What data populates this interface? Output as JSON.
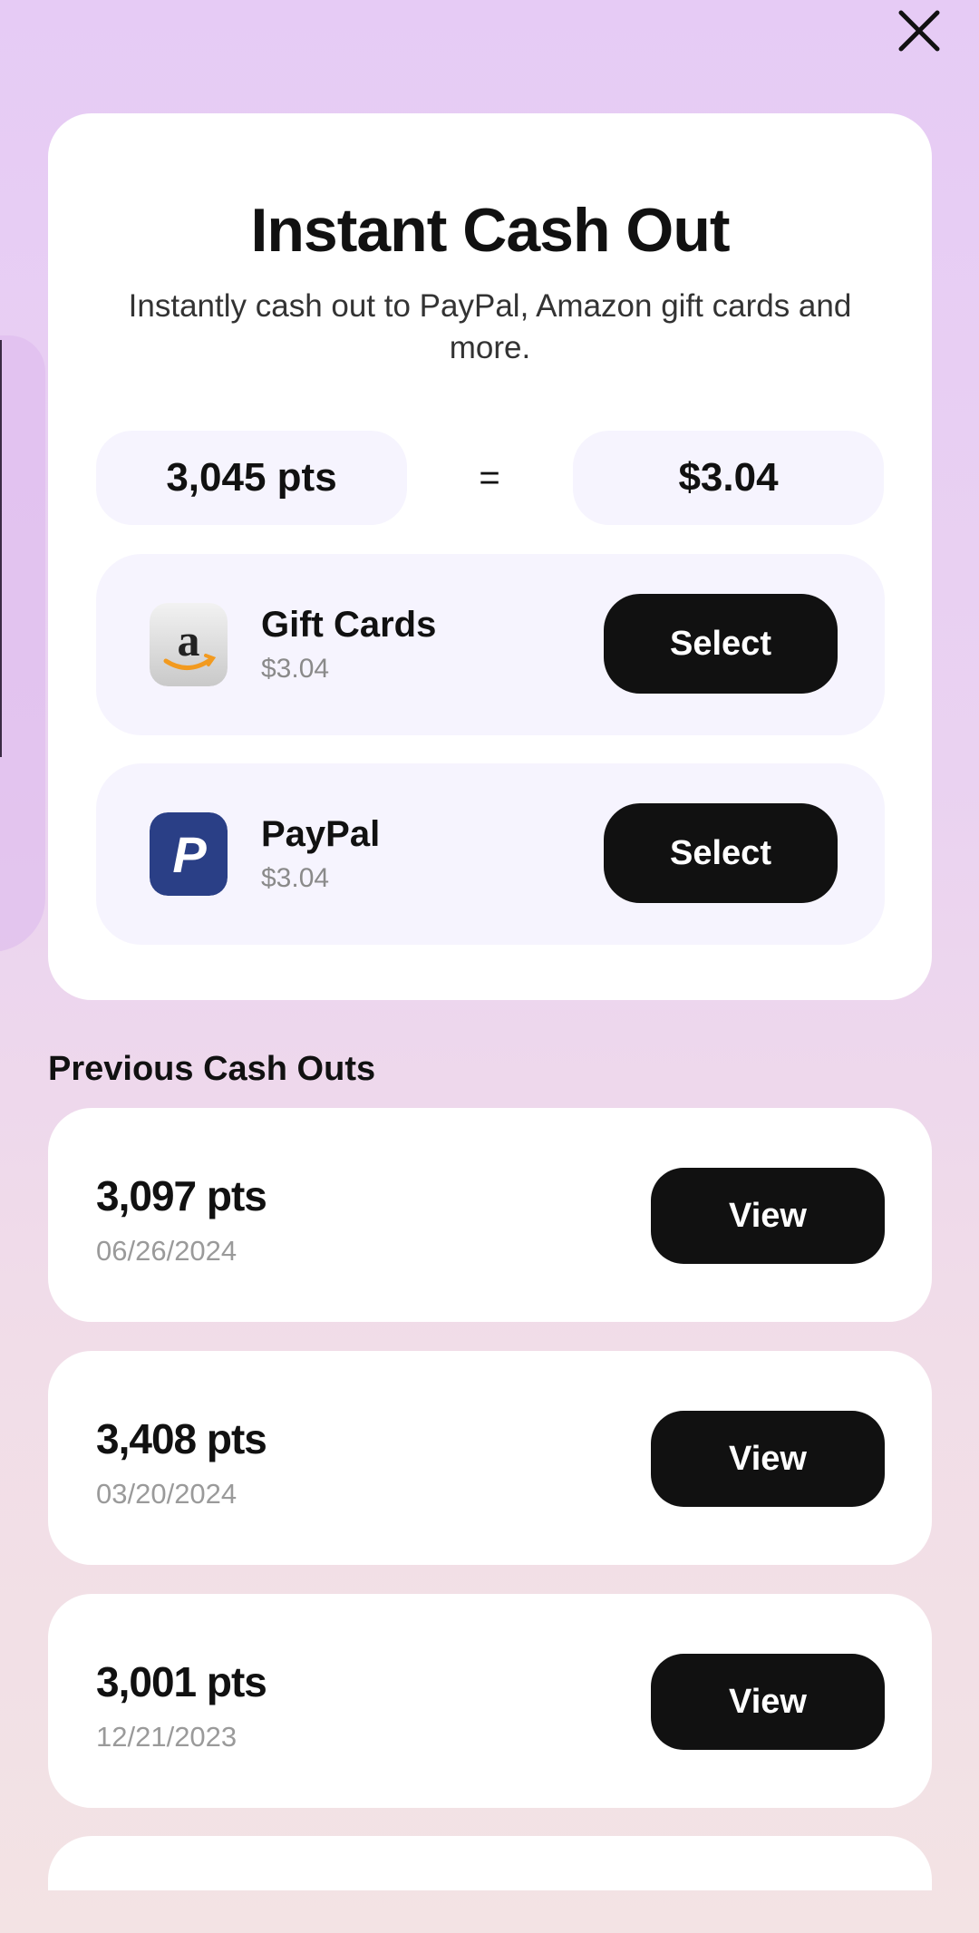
{
  "header": {
    "close_icon": "close-icon"
  },
  "cashout": {
    "title": "Instant Cash Out",
    "subtitle": "Instantly cash out to PayPal, Amazon gift cards and more.",
    "points": "3,045 pts",
    "equals": "=",
    "amount": "$3.04",
    "options": [
      {
        "name": "Gift Cards",
        "value": "$3.04",
        "icon": "amazon-logo-icon",
        "button": "Select"
      },
      {
        "name": "PayPal",
        "value": "$3.04",
        "icon": "paypal-logo-icon",
        "button": "Select"
      }
    ]
  },
  "history": {
    "title": "Previous Cash Outs",
    "items": [
      {
        "points": "3,097 pts",
        "date": "06/26/2024",
        "button": "View"
      },
      {
        "points": "3,408 pts",
        "date": "03/20/2024",
        "button": "View"
      },
      {
        "points": "3,001 pts",
        "date": "12/21/2023",
        "button": "View"
      }
    ]
  },
  "colors": {
    "button_bg": "#111111",
    "pill_bg": "#f6f4fe",
    "paypal_blue": "#2a3f86"
  }
}
